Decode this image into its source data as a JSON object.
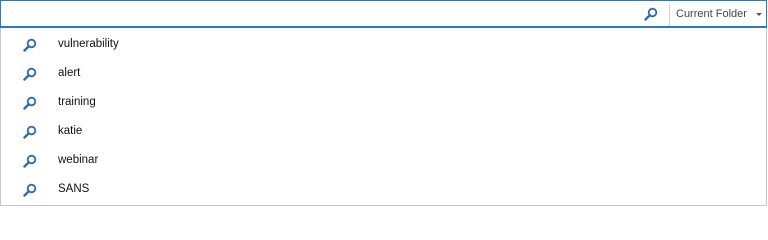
{
  "search": {
    "value": "",
    "placeholder": "",
    "scope_label": "Current Folder"
  },
  "icons": {
    "search_button": "search-icon",
    "suggestion": "search-icon",
    "scope_chevron": "chevron-down-icon"
  },
  "colors": {
    "accent": "#2b79c2",
    "icon": "#2b6cb4",
    "text": "#111111",
    "border": "#c6c6c6"
  },
  "suggestions": [
    {
      "label": "vulnerability"
    },
    {
      "label": "alert"
    },
    {
      "label": "training"
    },
    {
      "label": "katie"
    },
    {
      "label": "webinar"
    },
    {
      "label": "SANS"
    }
  ]
}
